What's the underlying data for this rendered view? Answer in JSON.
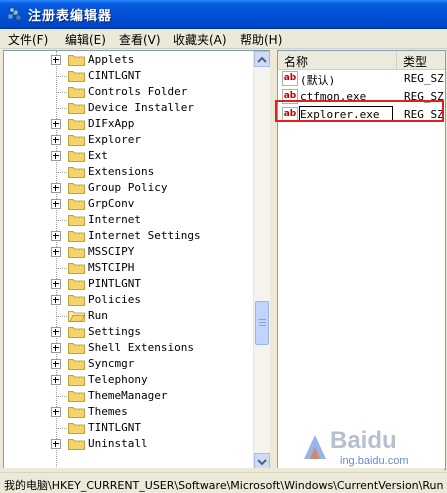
{
  "window": {
    "title": "注册表编辑器"
  },
  "menu": [
    {
      "label": "文件(F)"
    },
    {
      "label": "编辑(E)"
    },
    {
      "label": "查看(V)"
    },
    {
      "label": "收藏夹(A)"
    },
    {
      "label": "帮助(H)"
    }
  ],
  "tree": {
    "items": [
      {
        "label": "Applets",
        "expandable": true
      },
      {
        "label": "CINTLGNT",
        "expandable": false
      },
      {
        "label": "Controls Folder",
        "expandable": false
      },
      {
        "label": "Device Installer",
        "expandable": false
      },
      {
        "label": "DIFxApp",
        "expandable": true
      },
      {
        "label": "Explorer",
        "expandable": true
      },
      {
        "label": "Ext",
        "expandable": true
      },
      {
        "label": "Extensions",
        "expandable": false
      },
      {
        "label": "Group Policy",
        "expandable": true
      },
      {
        "label": "GrpConv",
        "expandable": true
      },
      {
        "label": "Internet",
        "expandable": false
      },
      {
        "label": "Internet Settings",
        "expandable": true
      },
      {
        "label": "MSSCIPY",
        "expandable": true
      },
      {
        "label": "MSTCIPH",
        "expandable": false
      },
      {
        "label": "PINTLGNT",
        "expandable": true
      },
      {
        "label": "Policies",
        "expandable": true
      },
      {
        "label": "Run",
        "expandable": false,
        "open": true
      },
      {
        "label": "Settings",
        "expandable": true
      },
      {
        "label": "Shell Extensions",
        "expandable": true
      },
      {
        "label": "Syncmgr",
        "expandable": true
      },
      {
        "label": "Telephony",
        "expandable": true
      },
      {
        "label": "ThemeManager",
        "expandable": false
      },
      {
        "label": "Themes",
        "expandable": true
      },
      {
        "label": "TINTLGNT",
        "expandable": false
      },
      {
        "label": "Uninstall",
        "expandable": true
      }
    ]
  },
  "values": {
    "headers": {
      "name": "名称",
      "type": "类型"
    },
    "rows": [
      {
        "name": "(默认)",
        "type": "REG_SZ"
      },
      {
        "name": "ctfmon.exe",
        "type": "REG_SZ"
      },
      {
        "name": "Explorer.exe",
        "type": "REG_SZ",
        "editing": true
      }
    ],
    "highlight_color": "#e02020"
  },
  "status": {
    "path": "我的电脑\\HKEY_CURRENT_USER\\Software\\Microsoft\\Windows\\CurrentVersion\\Run"
  },
  "watermark": {
    "brand": "Baidu",
    "sub": "ing.baidu.com"
  },
  "colors": {
    "titlebar": "#0150d6",
    "chrome": "#ece9d8",
    "folder": "#f5d36b"
  }
}
